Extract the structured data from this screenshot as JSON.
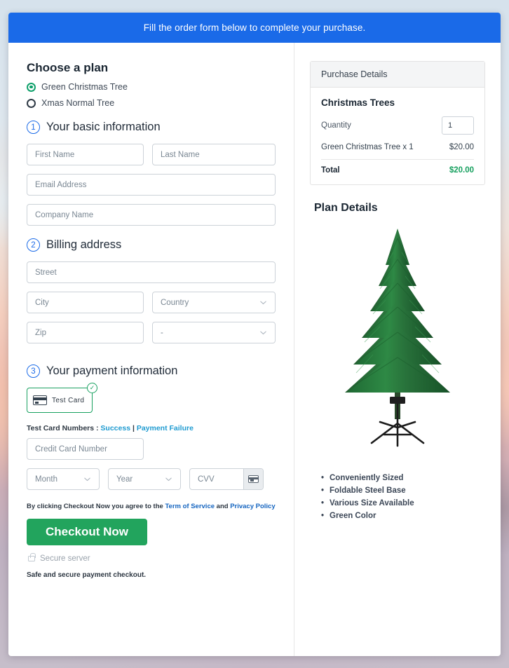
{
  "banner": {
    "text": "Fill the order form below to complete your purchase."
  },
  "plan": {
    "heading": "Choose a plan",
    "options": [
      {
        "label": "Green Christmas Tree",
        "selected": true
      },
      {
        "label": "Xmas Normal Tree",
        "selected": false
      }
    ]
  },
  "steps": {
    "basic": {
      "number": "1",
      "label": "Your basic information"
    },
    "billing": {
      "number": "2",
      "label": "Billing address"
    },
    "payment": {
      "number": "3",
      "label": "Your payment information"
    }
  },
  "basic_fields": {
    "first_name": {
      "placeholder": "First Name",
      "value": ""
    },
    "last_name": {
      "placeholder": "Last Name",
      "value": ""
    },
    "email": {
      "placeholder": "Email Address",
      "value": ""
    },
    "company": {
      "placeholder": "Company Name",
      "value": ""
    }
  },
  "billing_fields": {
    "street": {
      "placeholder": "Street",
      "value": ""
    },
    "city": {
      "placeholder": "City",
      "value": ""
    },
    "country": {
      "placeholder": "Country",
      "value": ""
    },
    "zip": {
      "placeholder": "Zip",
      "value": ""
    },
    "state": {
      "placeholder": "-",
      "value": "-"
    }
  },
  "payment": {
    "card_tile_label": "Test  Card",
    "card_tile_selected": true,
    "test_numbers_prefix": "Test Card Numbers : ",
    "test_numbers_success": "Success",
    "test_numbers_separator": " | ",
    "test_numbers_failure": "Payment Failure",
    "credit_card": {
      "placeholder": "Credit Card Number",
      "value": ""
    },
    "month": {
      "placeholder": "Month",
      "value": ""
    },
    "year": {
      "placeholder": "Year",
      "value": ""
    },
    "cvv": {
      "placeholder": "CVV",
      "value": ""
    }
  },
  "footer": {
    "terms_prefix": "By clicking Checkout Now you agree to the ",
    "terms_link": "Term of Service",
    "terms_mid": " and ",
    "privacy_link": "Privacy Policy",
    "checkout_label": "Checkout Now",
    "secure_label": "Secure server",
    "safe_note": "Safe and secure payment checkout."
  },
  "purchase": {
    "panel_title": "Purchase Details",
    "product_title": "Christmas Trees",
    "quantity_label": "Quantity",
    "quantity_value": "1",
    "line_item_label": "Green Christmas Tree x 1",
    "line_item_amount": "$20.00",
    "total_label": "Total",
    "total_amount": "$20.00"
  },
  "plan_details": {
    "title": "Plan Details",
    "features": [
      "Conveniently Sized",
      "Foldable Steel Base",
      "Various Size Available",
      "Green Color"
    ]
  },
  "colors": {
    "banner_blue": "#1a6ae8",
    "accent_green": "#17a05f",
    "checkout_green": "#22a45d",
    "link_blue": "#1f9bd1",
    "step_blue": "#1a6ae8"
  }
}
